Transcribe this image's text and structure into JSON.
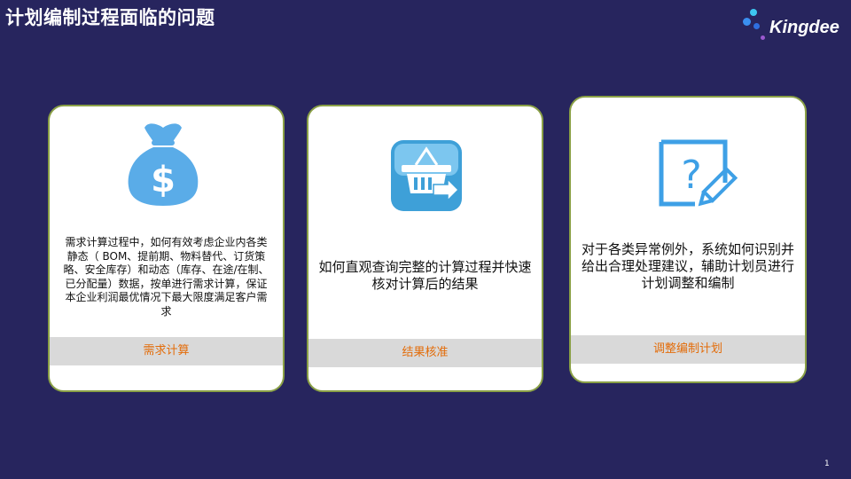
{
  "title": "计划编制过程面临的问题",
  "logo": {
    "text": "Kingdee"
  },
  "cards": [
    {
      "icon": "money-bag-icon",
      "description": "需求计算过程中，如何有效考虑企业内各类静态（ BOM、提前期、物料替代、订货策略、安全库存）和动态（库存、在途/在制、已分配量）数据，按单进行需求计算，保证本企业利润最优情况下最大限度满足客户需求",
      "label": "需求计算"
    },
    {
      "icon": "shopping-basket-icon",
      "description": "如何直观查询完整的计算过程并快速核对计算后的结果",
      "label": "结果核准"
    },
    {
      "icon": "question-edit-icon",
      "description": "对于各类异常例外，系统如何识别并给出合理处理建议，辅助计划员进行计划调整和编制",
      "label": "调整编制计划"
    }
  ],
  "page_number": "1",
  "colors": {
    "background": "#27255e",
    "card_border": "#8aa046",
    "label_text": "#e36c09",
    "icon_blue": "#5aace8"
  }
}
